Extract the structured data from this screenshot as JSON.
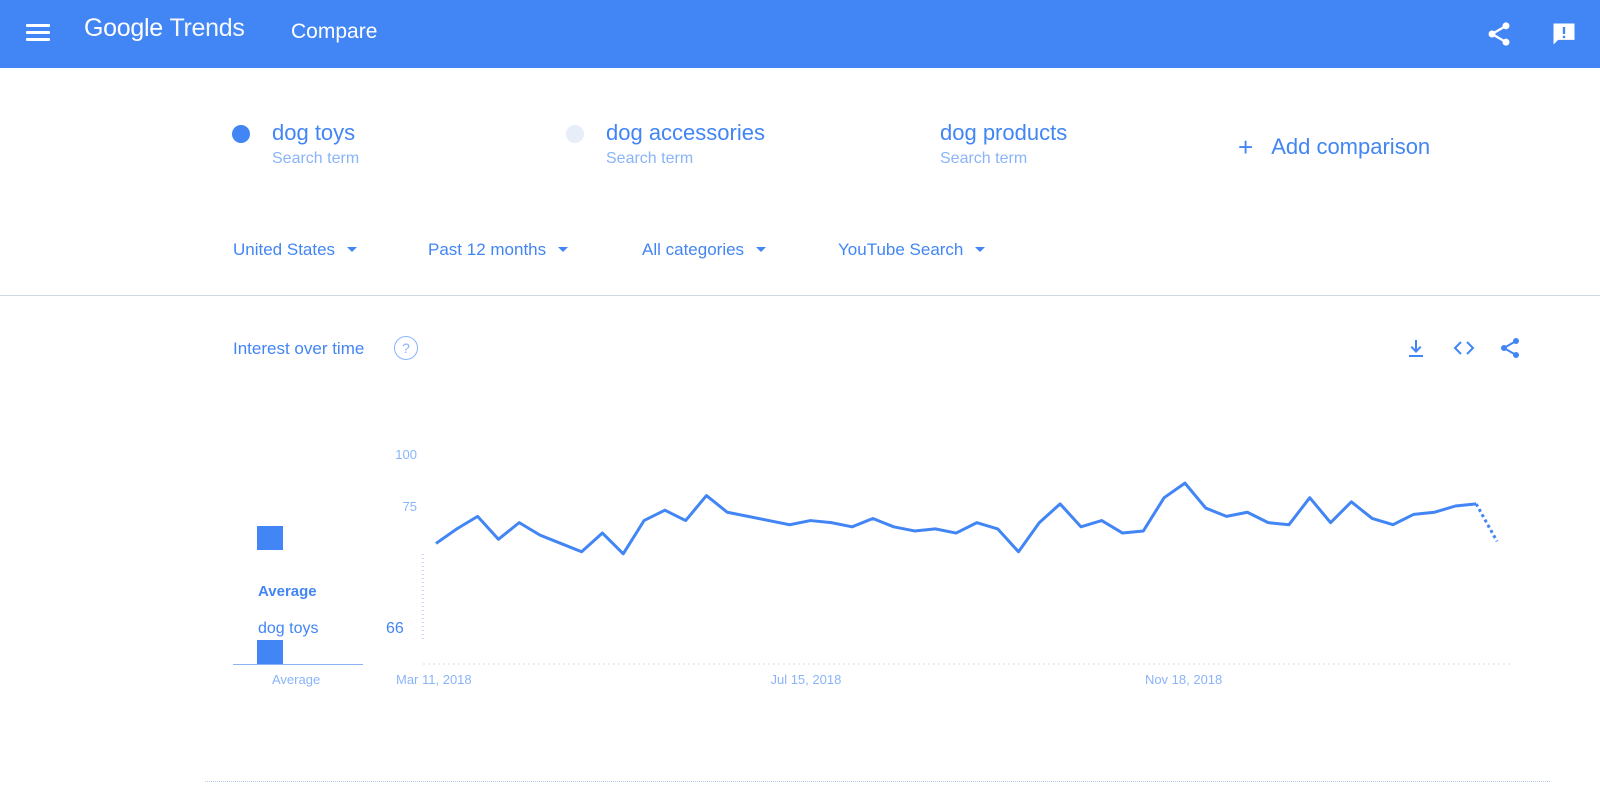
{
  "header": {
    "brand_google": "Google",
    "brand_trends": "Trends",
    "page_title": "Compare",
    "color": "#4285f4"
  },
  "terms": [
    {
      "name": "dog toys",
      "sub": "Search term",
      "color": "#4285f4"
    },
    {
      "name": "dog accessories",
      "sub": "Search term",
      "color": "#e8eef8"
    },
    {
      "name": "dog products",
      "sub": "Search term",
      "color": "#ffffff"
    }
  ],
  "add_comparison": {
    "plus": "+",
    "label": "Add comparison"
  },
  "filters": {
    "region": "United States",
    "time": "Past 12 months",
    "category": "All categories",
    "search_type": "YouTube Search"
  },
  "interest_card": {
    "title": "Interest over time",
    "help": "?",
    "average_label": "Average",
    "average_term": "dog toys",
    "average_value": "66",
    "average_bottom": "Average"
  },
  "chart_data": {
    "type": "line",
    "y_ticks": [
      "100",
      "75"
    ],
    "x_ticks": [
      "Mar 11, 2018",
      "Jul 15, 2018",
      "Nov 18, 2018"
    ],
    "ylim": [
      0,
      100
    ],
    "series": [
      {
        "name": "dog toys",
        "color": "#4285f4",
        "values": [
          57,
          64,
          70,
          59,
          67,
          61,
          57,
          53,
          62,
          52,
          68,
          73,
          68,
          80,
          72,
          70,
          68,
          66,
          68,
          67,
          65,
          69,
          65,
          63,
          64,
          62,
          67,
          64,
          53,
          67,
          76,
          65,
          68,
          62,
          63,
          79,
          86,
          74,
          70,
          72,
          67,
          66,
          79,
          67,
          77,
          69,
          66,
          71,
          72,
          75,
          76,
          58
        ],
        "last_point_partial": true
      }
    ]
  }
}
